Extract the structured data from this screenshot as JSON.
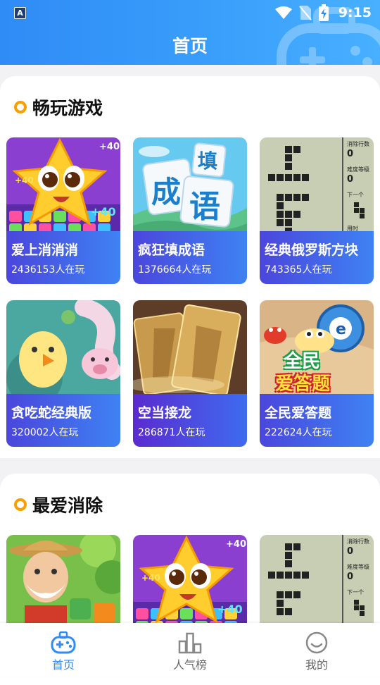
{
  "status_bar": {
    "app_icon_letter": "A",
    "time": "9:15"
  },
  "header": {
    "title": "首页"
  },
  "sections": [
    {
      "title": "畅玩游戏",
      "games": [
        {
          "name": "爱上消消消",
          "players": "2436153人在玩",
          "art_labels": [
            "+40",
            "+40",
            "+40"
          ]
        },
        {
          "name": "疯狂填成语",
          "players": "1376664人在玩",
          "art_labels": [
            "成",
            "填",
            "语"
          ]
        },
        {
          "name": "经典俄罗斯方块",
          "players": "743365人在玩",
          "art_labels": [
            "消除行数",
            "0",
            "难度等级",
            "0",
            "下一个",
            "用时"
          ]
        },
        {
          "name": "贪吃蛇经典版",
          "players": "320002人在玩"
        },
        {
          "name": "空当接龙",
          "players": "286871人在玩"
        },
        {
          "name": "全民爱答题",
          "players": "222624人在玩",
          "art_labels": [
            "全民",
            "爱答题"
          ]
        }
      ]
    },
    {
      "title": "最爱消除",
      "games": [
        {
          "name": "",
          "players": ""
        },
        {
          "name": "",
          "players": "",
          "art_labels": [
            "+40",
            "+40",
            "+40"
          ]
        },
        {
          "name": "",
          "players": "",
          "art_labels": [
            "消除行数",
            "0",
            "难度等级",
            "0",
            "下一个"
          ]
        }
      ]
    }
  ],
  "bottom_nav": [
    {
      "label": "首页",
      "icon": "gamepad-icon",
      "active": true
    },
    {
      "label": "人气榜",
      "icon": "bar-chart-icon",
      "active": false
    },
    {
      "label": "我的",
      "icon": "smiley-icon",
      "active": false
    }
  ],
  "colors": {
    "primary": "#2f8bf6",
    "accent_dot": "#f7a000",
    "nav_active": "#2f8bf6",
    "nav_inactive": "#666666"
  }
}
